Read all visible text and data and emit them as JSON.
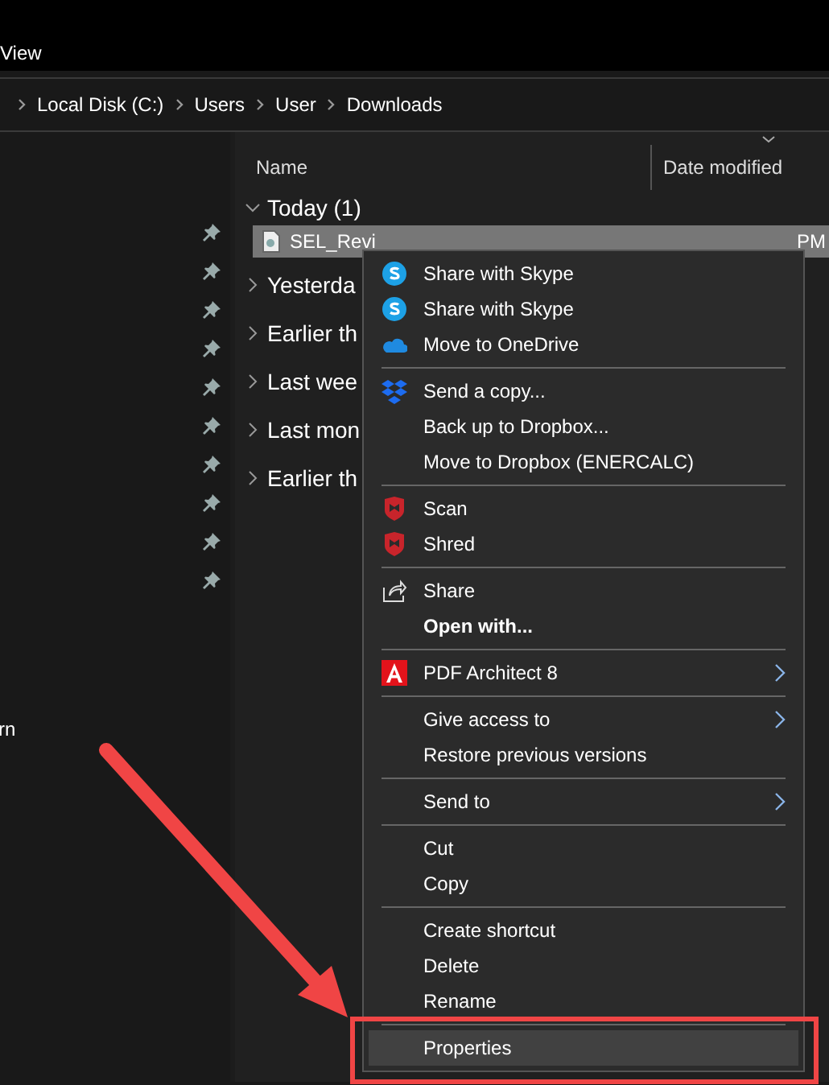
{
  "menu_bar": {
    "label": "View"
  },
  "address_bar": {
    "crumbs": [
      "Local Disk (C:)",
      "Users",
      "User",
      "Downloads"
    ]
  },
  "sidebar": {
    "text": "rn"
  },
  "file_list": {
    "columns": [
      "Name",
      "Date modified"
    ],
    "groups": [
      {
        "label": "Today (1)",
        "expanded": true
      },
      {
        "label": "Yesterda",
        "expanded": false
      },
      {
        "label": "Earlier th",
        "expanded": false
      },
      {
        "label": "Last wee",
        "expanded": false
      },
      {
        "label": "Last mon",
        "expanded": false
      },
      {
        "label": "Earlier th",
        "expanded": false
      }
    ],
    "file": {
      "name": "SEL_Revi",
      "date": "PM",
      "selected": true
    }
  },
  "context_menu": {
    "items": [
      {
        "kind": "skype",
        "label": "Share with Skype",
        "selected": false
      },
      {
        "kind": "skype",
        "label": "Share with Skype",
        "selected": false
      },
      {
        "kind": "cloud",
        "label": "Move to OneDrive",
        "selected": false
      },
      {
        "kind": "separator"
      },
      {
        "kind": "boxes",
        "label": "Send a copy...",
        "selected": false
      },
      {
        "kind": "plain",
        "label": "Back up to Dropbox...",
        "selected": false
      },
      {
        "kind": "plain",
        "label": "Move to Dropbox (ENERCALC)",
        "selected": false
      },
      {
        "kind": "separator"
      },
      {
        "kind": "shield",
        "label": "Scan",
        "selected": false
      },
      {
        "kind": "shield",
        "label": "Shred",
        "selected": false
      },
      {
        "kind": "separator"
      },
      {
        "kind": "share",
        "label": "Share",
        "selected": false
      },
      {
        "kind": "plain",
        "label": "Open with...",
        "bold": true,
        "selected": false
      },
      {
        "kind": "separator"
      },
      {
        "kind": "pdf",
        "label": "PDF Architect 8",
        "submenu": true,
        "selected": false
      },
      {
        "kind": "separator"
      },
      {
        "kind": "plain",
        "label": "Give access to",
        "submenu": true,
        "selected": false
      },
      {
        "kind": "plain",
        "label": "Restore previous versions",
        "selected": false
      },
      {
        "kind": "separator"
      },
      {
        "kind": "plain",
        "label": "Send to",
        "submenu": true,
        "selected": false
      },
      {
        "kind": "separator"
      },
      {
        "kind": "plain",
        "label": "Cut",
        "selected": false
      },
      {
        "kind": "plain",
        "label": "Copy",
        "selected": false
      },
      {
        "kind": "separator"
      },
      {
        "kind": "plain",
        "label": "Create shortcut",
        "selected": false
      },
      {
        "kind": "plain",
        "label": "Delete",
        "selected": false
      },
      {
        "kind": "plain",
        "label": "Rename",
        "selected": false
      },
      {
        "kind": "separator"
      },
      {
        "kind": "plain",
        "label": "Properties",
        "selected": true
      }
    ]
  }
}
